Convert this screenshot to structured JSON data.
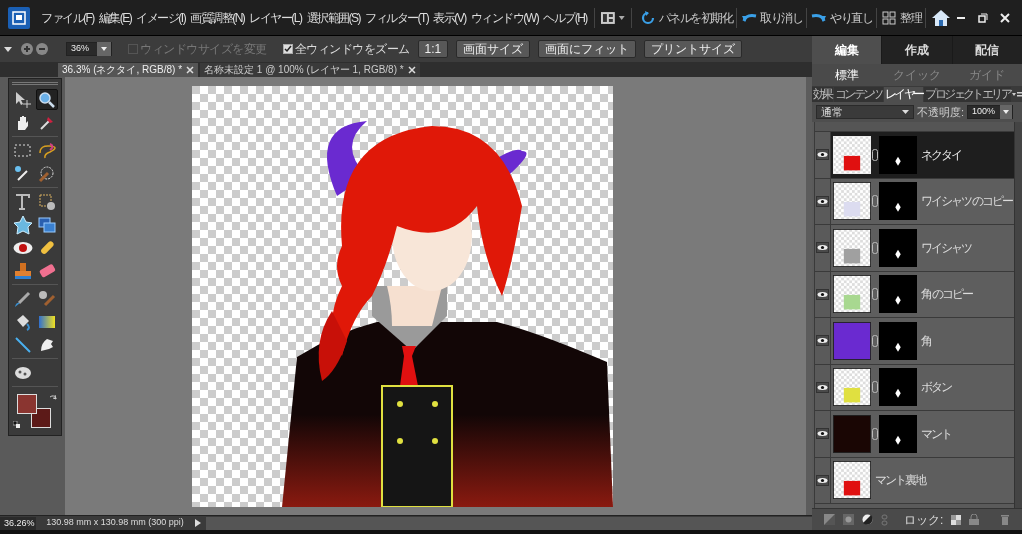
{
  "menu": [
    "ファイル(F)",
    "編集(E)",
    "イメージ(I)",
    "画質調整(N)",
    "レイヤー(L)",
    "選択範囲(S)",
    "フィルター(T)",
    "表示(V)",
    "ウィンドウ(W)",
    "ヘルプ(H)"
  ],
  "top_actions": [
    {
      "kind": "reset",
      "label": "パネルを初期化"
    },
    {
      "kind": "undo",
      "label": "取り消し"
    },
    {
      "kind": "redo",
      "label": "やり直し"
    },
    {
      "kind": "organize",
      "label": "整理"
    }
  ],
  "options": {
    "zoom": "36%",
    "resize_windows": {
      "label": "ウィンドウサイズを変更",
      "checked": false,
      "disabled": true
    },
    "zoom_all": {
      "label": "全ウィンドウをズーム",
      "checked": true,
      "disabled": false
    },
    "buttons": [
      "1:1",
      "画面サイズ",
      "画面にフィット",
      "プリントサイズ"
    ]
  },
  "documents": [
    {
      "title": "36.3% (ネクタイ, RGB/8) *",
      "selected": true
    },
    {
      "title": "名称未設定 1 @ 100% (レイヤー 1, RGB/8) *",
      "selected": false
    }
  ],
  "tools": [
    [
      {
        "kind": "move",
        "selected": false
      },
      {
        "kind": "zoom",
        "selected": true
      }
    ],
    [
      {
        "kind": "hand",
        "selected": false
      },
      {
        "kind": "eyedropper",
        "selected": false
      }
    ],
    [
      {
        "kind": "marquee",
        "selected": false
      },
      {
        "kind": "lasso",
        "selected": false
      }
    ],
    [
      {
        "kind": "wand",
        "selected": false
      },
      {
        "kind": "quickselect",
        "selected": false
      }
    ],
    [
      {
        "kind": "type",
        "selected": false
      },
      {
        "kind": "crop",
        "selected": false
      }
    ],
    [
      {
        "kind": "shape",
        "selected": false
      },
      {
        "kind": "recompose",
        "selected": false
      }
    ],
    [
      {
        "kind": "redeye",
        "selected": false
      },
      {
        "kind": "healing",
        "selected": false
      }
    ],
    [
      {
        "kind": "stamp",
        "selected": false
      },
      {
        "kind": "eraser",
        "selected": false
      }
    ],
    [
      {
        "kind": "brush",
        "selected": false
      },
      {
        "kind": "smartbrush",
        "selected": false
      }
    ],
    [
      {
        "kind": "bucket",
        "selected": false
      },
      {
        "kind": "gradient",
        "selected": false
      }
    ],
    [
      {
        "kind": "line",
        "selected": false
      },
      {
        "kind": "smudge",
        "selected": false
      }
    ],
    [
      {
        "kind": "sponge",
        "selected": false
      }
    ]
  ],
  "colors": [
    {
      "kind": "background",
      "color": "#5c1a18"
    },
    {
      "kind": "foreground",
      "color": "#8a3530"
    }
  ],
  "modes": [
    {
      "label": "編集",
      "selected": true
    },
    {
      "label": "作成",
      "selected": false
    },
    {
      "label": "配信",
      "selected": false
    }
  ],
  "submodes": [
    {
      "label": "標準",
      "selected": true
    },
    {
      "label": "クイック",
      "selected": false
    },
    {
      "label": "ガイド",
      "selected": false
    }
  ],
  "panel_tabs": [
    {
      "label": "効果",
      "selected": false
    },
    {
      "label": "コンテンツ",
      "selected": false
    },
    {
      "label": "レイヤー",
      "selected": true
    },
    {
      "label": "プロジェクトエリア",
      "selected": false
    }
  ],
  "blend_mode": "通常",
  "opacity_label": "不透明度:",
  "opacity": "100%",
  "layers": [
    {
      "name": "ネクタイ",
      "selected": true,
      "visible": true,
      "kind": "checker",
      "color": "#e01010",
      "mask": true
    },
    {
      "name": "ワイシャツ のコピー",
      "selected": false,
      "visible": true,
      "kind": "checker",
      "color": "#dcdcf0",
      "mask": true
    },
    {
      "name": "ワイシャツ",
      "selected": false,
      "visible": true,
      "kind": "checker",
      "color": "#a0a0a0",
      "mask": true
    },
    {
      "name": "角 のコピー",
      "selected": false,
      "visible": true,
      "kind": "checker",
      "color": "#a8d890",
      "mask": true
    },
    {
      "name": "角",
      "selected": false,
      "visible": true,
      "kind": "fill",
      "color": "#6a2ad0",
      "mask": true
    },
    {
      "name": "ボタン",
      "selected": false,
      "visible": true,
      "kind": "checker",
      "color": "#e0e040",
      "mask": true
    },
    {
      "name": "マント",
      "selected": false,
      "visible": true,
      "kind": "fill",
      "color": "#1a0604",
      "mask": true
    },
    {
      "name": "マント裏地",
      "selected": false,
      "visible": true,
      "kind": "checker",
      "color": "#e01010",
      "mask": false
    }
  ],
  "lock_label": "ロック:",
  "status": {
    "zoom": "36.26%",
    "size": "130.98 mm x 130.98 mm (300 ppi)"
  }
}
